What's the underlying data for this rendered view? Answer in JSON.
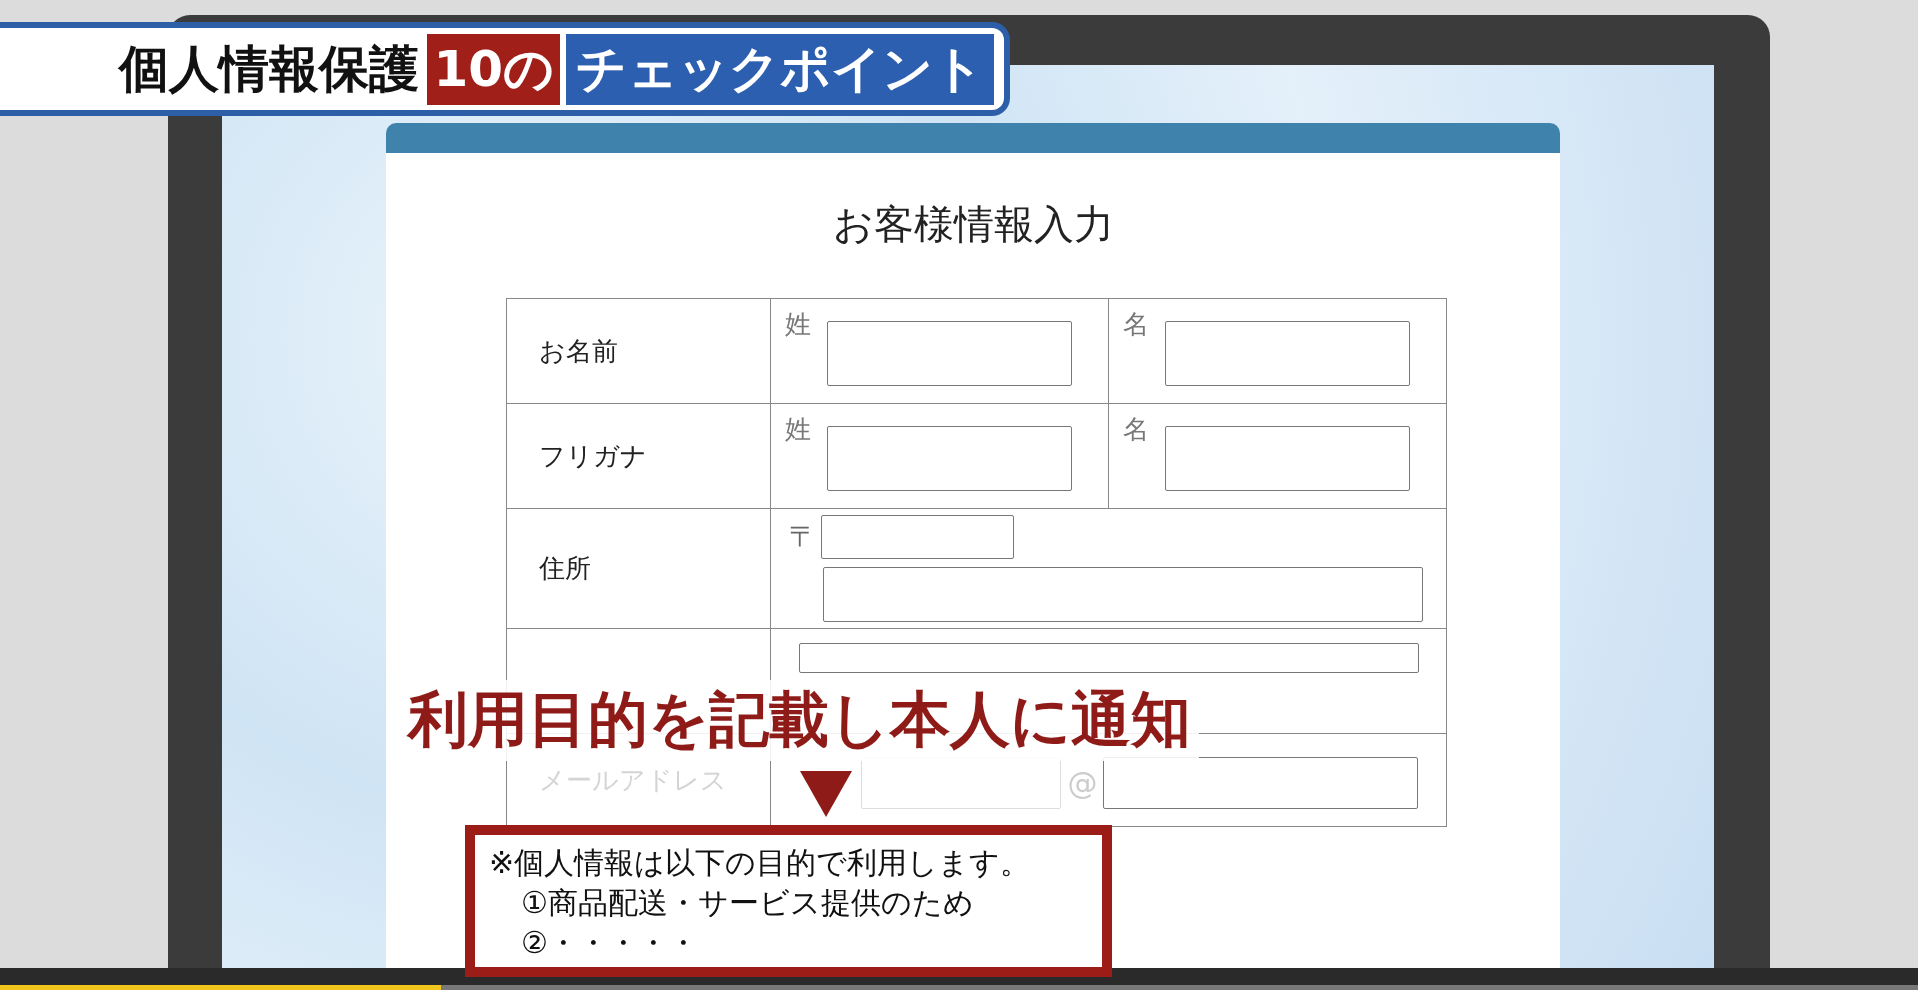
{
  "banner": {
    "title": "個人情報保護",
    "number": "10の",
    "subtitle": "チェックポイント"
  },
  "form": {
    "title": "お客様情報入力",
    "rows": [
      {
        "kind": "split",
        "label": "お名前",
        "fields": [
          {
            "caption": "姓"
          },
          {
            "caption": "名"
          }
        ]
      },
      {
        "kind": "split",
        "label": "フリガナ",
        "fields": [
          {
            "caption": "姓"
          },
          {
            "caption": "名"
          }
        ]
      },
      {
        "kind": "address",
        "label": "住所",
        "postal_mark": "〒"
      },
      {
        "kind": "single"
      },
      {
        "kind": "email",
        "label": "メールアドレス",
        "at": "@"
      }
    ]
  },
  "callout": {
    "heading": "利用目的を記載し本人に通知",
    "lines": [
      "※個人情報は以下の目的で利用します。",
      "①商品配送・サービス提供のため",
      "②・・・・・"
    ]
  },
  "video": {
    "level": 0.23
  }
}
